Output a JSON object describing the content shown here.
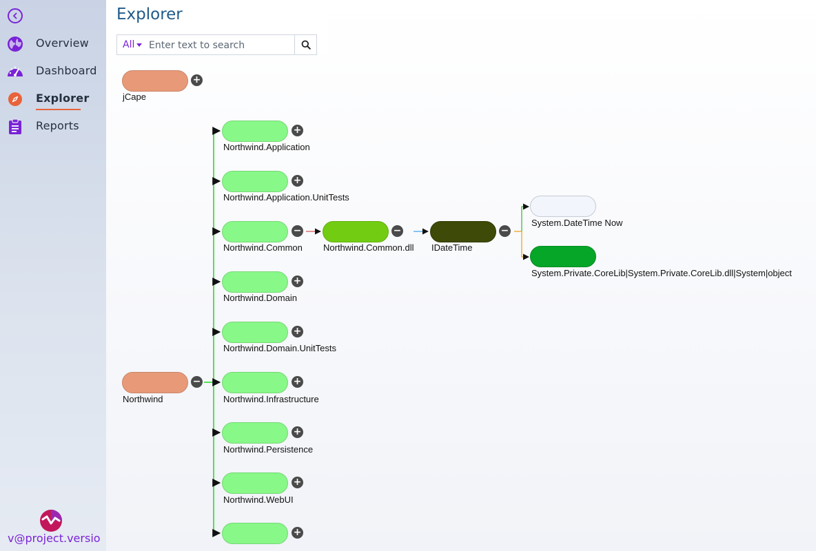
{
  "sidebar": {
    "items": [
      {
        "label": "Overview",
        "icon": "globe-icon",
        "active": false
      },
      {
        "label": "Dashboard",
        "icon": "speedometer-icon",
        "active": false
      },
      {
        "label": "Explorer",
        "icon": "compass-icon",
        "active": true
      },
      {
        "label": "Reports",
        "icon": "clipboard-icon",
        "active": false
      }
    ],
    "brand": "v@project.versio"
  },
  "header": {
    "title": "Explorer",
    "search": {
      "filter": "All",
      "placeholder": "Enter text to search"
    }
  },
  "graph": {
    "nodes": {
      "jcape": {
        "label": "jCape",
        "color": "#e89a78",
        "toggle": "+"
      },
      "northwind": {
        "label": "Northwind",
        "color": "#e89a78",
        "toggle": "−"
      },
      "application": {
        "label": "Northwind.Application",
        "color": "#88f888",
        "toggle": "+"
      },
      "application_tests": {
        "label": "Northwind.Application.UnitTests",
        "color": "#88f888",
        "toggle": "+"
      },
      "common": {
        "label": "Northwind.Common",
        "color": "#88f888",
        "toggle": "−"
      },
      "domain": {
        "label": "Northwind.Domain",
        "color": "#88f888",
        "toggle": "+"
      },
      "domain_tests": {
        "label": "Northwind.Domain.UnitTests",
        "color": "#88f888",
        "toggle": "+"
      },
      "infrastructure": {
        "label": "Northwind.Infrastructure",
        "color": "#88f888",
        "toggle": "+"
      },
      "persistence": {
        "label": "Northwind.Persistence",
        "color": "#88f888",
        "toggle": "+"
      },
      "webui": {
        "label": "Northwind.WebUI",
        "color": "#88f888",
        "toggle": "+"
      },
      "last": {
        "label": "",
        "color": "#88f888",
        "toggle": "+"
      },
      "common_dll": {
        "label": "Northwind.Common.dll",
        "color": "#72cc12",
        "toggle": "−"
      },
      "idatetime": {
        "label": "IDateTime",
        "color": "#3e4a07",
        "toggle": "−"
      },
      "datetime_now": {
        "label": "System.DateTime Now",
        "color": "#f2f5fb",
        "toggle": ""
      },
      "corelib": {
        "label": "System.Private.CoreLib|System.Private.CoreLib.dll|System|object",
        "color": "#06a628",
        "toggle": ""
      }
    },
    "edge_colors": {
      "northwind_children": "#55e055",
      "common_to_dll": "#e07070",
      "dll_to_idatetime": "#5ab4f0",
      "idatetime_to_now": "#55c455",
      "idatetime_to_corelib": "#f0b040"
    }
  }
}
